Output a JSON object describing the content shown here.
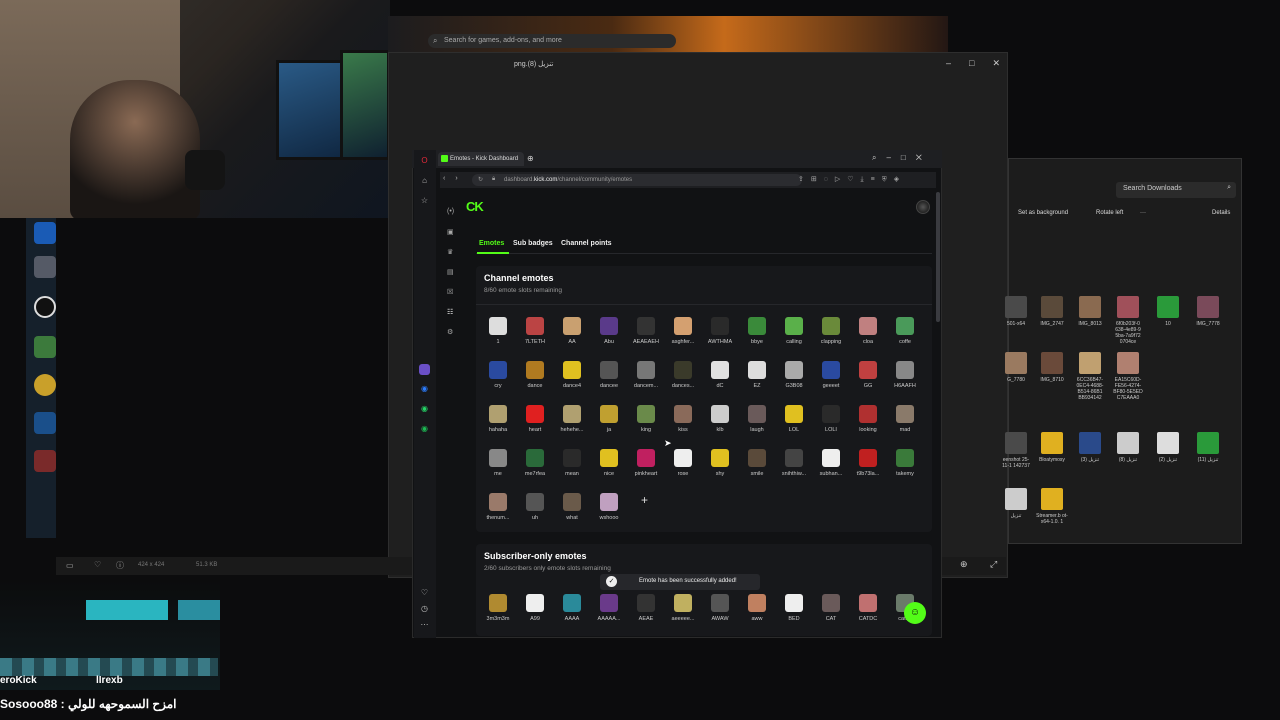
{
  "store": {
    "search_placeholder": "Search for games, add-ons, and more"
  },
  "photos": {
    "title": "png.(8) تنزيل",
    "status_dims": "424 x 424",
    "status_size": "51.3 KB"
  },
  "explorer": {
    "search_placeholder": "Search Downloads",
    "toolbar": [
      "Set as background",
      "Rotate left",
      "···",
      "Details"
    ],
    "files": [
      {
        "label": "501-x64"
      },
      {
        "label": "IMG_2747"
      },
      {
        "label": "IMG_8013"
      },
      {
        "label": "6f0b203f-0 638-4e89-9 5ba-7a9f72 0704ce"
      },
      {
        "label": "10"
      },
      {
        "label": "IMG_7778"
      },
      {
        "label": "G_7780"
      },
      {
        "label": "IMG_8710"
      },
      {
        "label": "6CC36B47- 0EC4-4688- B514-86B1 BB934142"
      },
      {
        "label": "EA15C60D- FE56-4274- BF80-5E5ED C7EAAA0"
      },
      {
        "label": "eenshot 25-11-1 142737"
      },
      {
        "label": "Bloatymosy"
      },
      {
        "label": "تنزيل (3)"
      },
      {
        "label": "تنزيل (8)"
      },
      {
        "label": "تنزيل (2)"
      },
      {
        "label": "تنزيل (11)"
      },
      {
        "label": "تنزيل"
      },
      {
        "label": "Streamer.b ot-x64-1.0. 1"
      }
    ]
  },
  "browser": {
    "tab_title": "Emotes - Kick Dashboard",
    "url_prefix": "dashboard.",
    "url_domain": "kick.com",
    "url_path": "/channel/community/emotes"
  },
  "dashboard": {
    "logo": "CK",
    "tabs": [
      {
        "label": "Emotes",
        "active": true
      },
      {
        "label": "Sub badges",
        "active": false
      },
      {
        "label": "Channel points",
        "active": false
      }
    ],
    "channel_section": {
      "title": "Channel emotes",
      "subtitle": "8/60 emote slots remaining",
      "emotes": [
        "1",
        "7LTETH",
        "AA",
        "Abu",
        "AEAEAEH",
        "asghfer...",
        "AWTHMA",
        "bbye",
        "calling",
        "clapping",
        "cloa",
        "coffe",
        "cry",
        "dance",
        "dance4",
        "dancee",
        "dancem...",
        "dances...",
        "dC",
        "EZ",
        "G3B08",
        "geeeet",
        "GG",
        "H6AAFH",
        "hahaha",
        "heart",
        "hehehe...",
        "ja",
        "king",
        "kiss",
        "klb",
        "laugh",
        "LOL",
        "LOLI",
        "looking",
        "mad",
        "me",
        "me7rfea",
        "mean",
        "nice",
        "pinkheart",
        "rose",
        "shy",
        "smile",
        "snihthiw...",
        "subhan...",
        "t9b73la...",
        "takemy",
        "thenum...",
        "uh",
        "what",
        "wshooo"
      ]
    },
    "subscriber_section": {
      "title": "Subscriber-only emotes",
      "subtitle": "2/60 subscribers only emote slots remaining",
      "emotes": [
        "3m3m3m",
        "A99",
        "AAAA",
        "AAAAA...",
        "AEAE",
        "aeeeee...",
        "AWAW",
        "aww",
        "BED",
        "CAT",
        "CATDC",
        "catt..."
      ]
    },
    "toast": "Emote has been successfully added!"
  },
  "chat": {
    "user1": "eroKick",
    "user2": "lIrexb",
    "line": "Sosooo88 : امزح السموحهه للولي"
  },
  "colors": {
    "kick_green": "#53fc18",
    "bg": "#111214",
    "panel": "#17181b"
  }
}
